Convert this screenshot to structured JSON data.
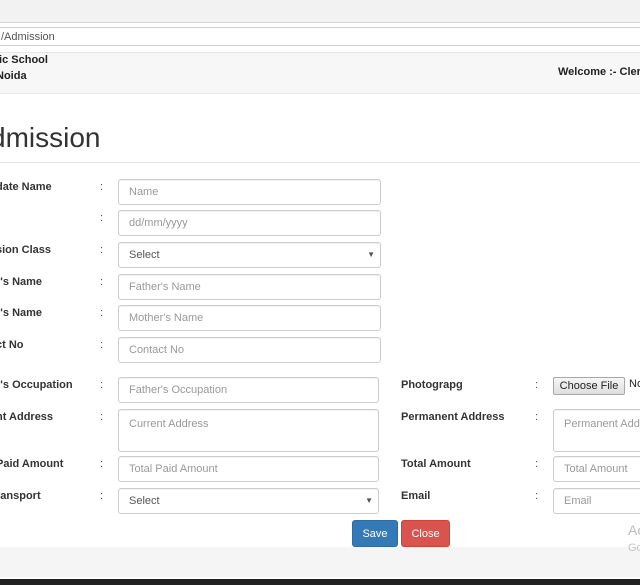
{
  "browser": {
    "url": "/Admission"
  },
  "header": {
    "school_line1": "lic School",
    "school_line2": "Noida",
    "welcome": "Welcome :- Cler"
  },
  "page": {
    "title": "dmission"
  },
  "form": {
    "colon": ":",
    "candidate_name": {
      "label": "date Name",
      "placeholder": "Name"
    },
    "dob": {
      "placeholder": "dd/mm/yyyy"
    },
    "admission_class": {
      "label": "sion Class",
      "selected": "Select"
    },
    "father_name": {
      "label": "r's Name",
      "placeholder": "Father's Name"
    },
    "mother_name": {
      "label": "r's Name",
      "placeholder": "Mother's Name"
    },
    "contact_no": {
      "label": "ct No",
      "placeholder": "Contact No"
    },
    "father_occupation": {
      "label": "r's Occupation",
      "placeholder": "Father's Occupation"
    },
    "photograph": {
      "label": "Photograpg",
      "button": "Choose File",
      "status": "No"
    },
    "current_address": {
      "label": "nt Address",
      "placeholder": "Current Address"
    },
    "permanent_address": {
      "label": "Permanent Address",
      "placeholder": "Permanent Addr"
    },
    "paid_amount": {
      "label": "Paid Amount",
      "placeholder": "Total Paid Amount"
    },
    "total_amount": {
      "label": "Total Amount",
      "placeholder": "Total Amount"
    },
    "transport": {
      "label": "ransport",
      "selected": "Select"
    },
    "email": {
      "label": "Email",
      "placeholder": "Email"
    }
  },
  "actions": {
    "save": "Save",
    "close": "Close"
  },
  "watermark": {
    "line1": "Ac",
    "line2": "Go"
  },
  "icons": {
    "select_caret": "caret-down-icon"
  }
}
